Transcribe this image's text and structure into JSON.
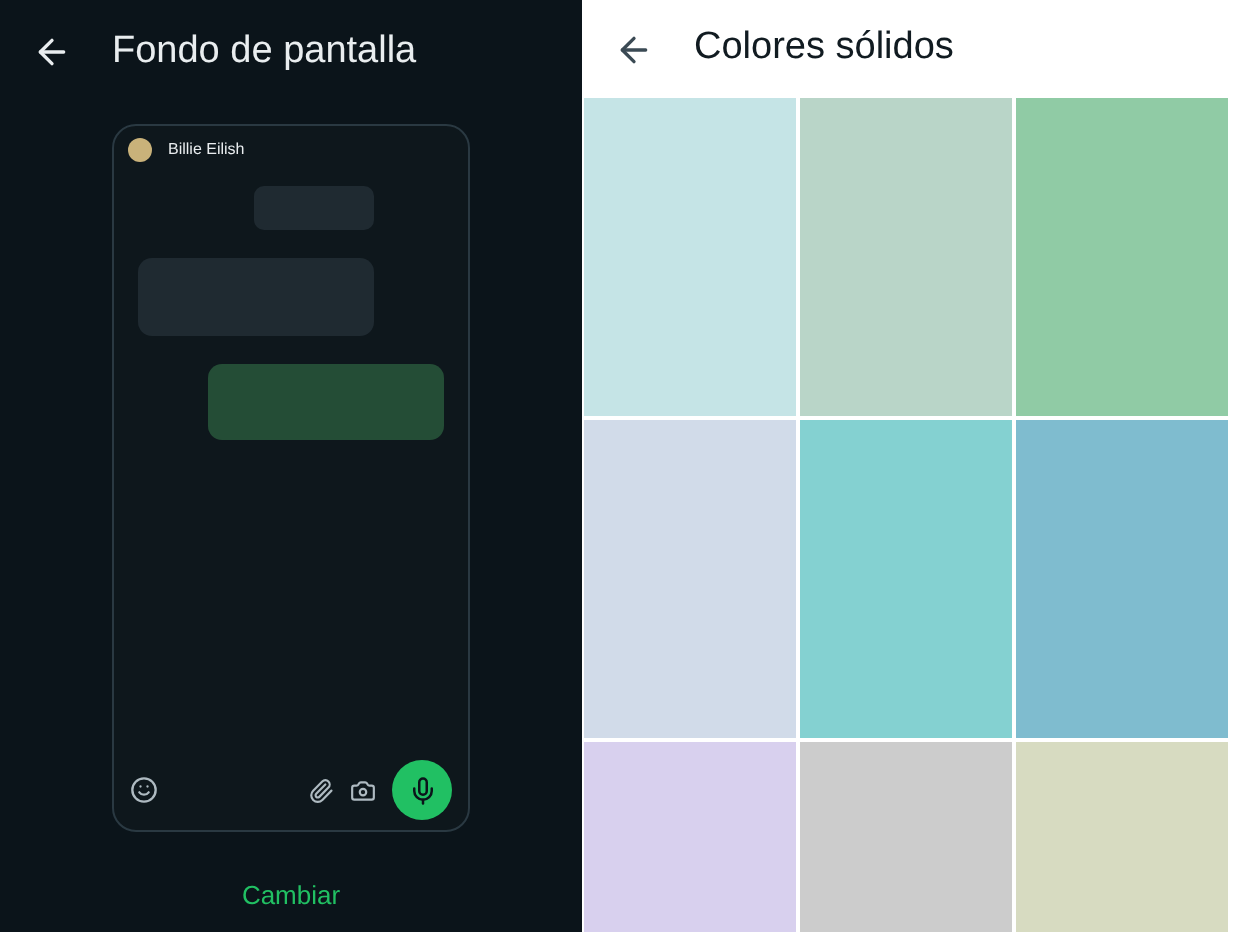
{
  "left": {
    "title": "Fondo de pantalla",
    "preview": {
      "contact": "Billie Eilish"
    },
    "action": "Cambiar"
  },
  "right": {
    "title": "Colores sólidos",
    "swatches": [
      {
        "color": "#c5e4e6"
      },
      {
        "color": "#b9d5c8"
      },
      {
        "color": "#90cba5"
      },
      {
        "color": "#d1dbe9"
      },
      {
        "color": "#84d1d1"
      },
      {
        "color": "#7fbccf"
      },
      {
        "color": "#d8d0ee"
      },
      {
        "color": "#cccccc"
      },
      {
        "color": "#d7dbc1"
      }
    ]
  }
}
